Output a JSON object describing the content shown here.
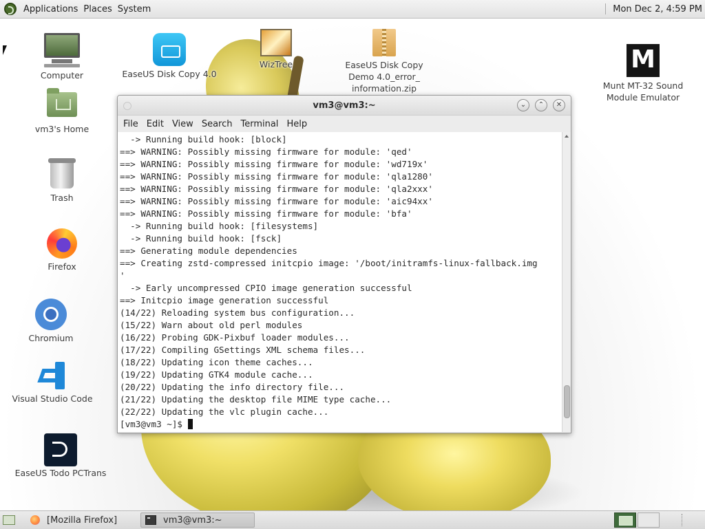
{
  "top_panel": {
    "menus": [
      "Applications",
      "Places",
      "System"
    ],
    "clock": "Mon Dec  2,  4:59 PM",
    "logo_icon": "distro-logo-icon"
  },
  "desktop_icons": [
    {
      "label": "Computer",
      "icon": "computer-icon"
    },
    {
      "label": "vm3's Home",
      "icon": "home-folder-icon"
    },
    {
      "label": "Trash",
      "icon": "trash-icon"
    },
    {
      "label": "Firefox",
      "icon": "firefox-icon"
    },
    {
      "label": "Chromium",
      "icon": "chromium-icon"
    },
    {
      "label": "Visual Studio Code",
      "icon": "vscode-icon"
    },
    {
      "label": "EaseUS Todo PCTrans",
      "icon": "pctrans-icon"
    },
    {
      "label": "EaseUS Disk Copy 4.0",
      "icon": "easeus-disk-copy-icon"
    },
    {
      "label": "WizTree",
      "icon": "wiztree-icon"
    },
    {
      "label": "EaseUS Disk Copy Demo 4.0_error_ information.zip",
      "label_lines": [
        "EaseUS Disk Copy",
        "Demo 4.0_error_",
        "information.zip"
      ],
      "icon": "zip-archive-icon"
    },
    {
      "label": "Munt MT-32 Sound Module Emulator",
      "label_lines": [
        "Munt MT-32 Sound",
        "Module Emulator"
      ],
      "icon": "munt-icon"
    }
  ],
  "terminal": {
    "title": "vm3@vm3:~",
    "menu": [
      "File",
      "Edit",
      "View",
      "Search",
      "Terminal",
      "Help"
    ],
    "lines": [
      "  -> Running build hook: [block]",
      "==> WARNING: Possibly missing firmware for module: 'qed'",
      "==> WARNING: Possibly missing firmware for module: 'wd719x'",
      "==> WARNING: Possibly missing firmware for module: 'qla1280'",
      "==> WARNING: Possibly missing firmware for module: 'qla2xxx'",
      "==> WARNING: Possibly missing firmware for module: 'aic94xx'",
      "==> WARNING: Possibly missing firmware for module: 'bfa'",
      "  -> Running build hook: [filesystems]",
      "  -> Running build hook: [fsck]",
      "==> Generating module dependencies",
      "==> Creating zstd-compressed initcpio image: '/boot/initramfs-linux-fallback.img",
      "'",
      "  -> Early uncompressed CPIO image generation successful",
      "==> Initcpio image generation successful",
      "(14/22) Reloading system bus configuration...",
      "(15/22) Warn about old perl modules",
      "(16/22) Probing GDK-Pixbuf loader modules...",
      "(17/22) Compiling GSettings XML schema files...",
      "(18/22) Updating icon theme caches...",
      "(19/22) Updating GTK4 module cache...",
      "(20/22) Updating the info directory file...",
      "(21/22) Updating the desktop file MIME type cache...",
      "(22/22) Updating the vlc plugin cache..."
    ],
    "prompt": "[vm3@vm3 ~]$ "
  },
  "taskbar": {
    "tasks": [
      {
        "label": "[Mozilla Firefox]",
        "icon": "firefox-icon",
        "active": false
      },
      {
        "label": "vm3@vm3:~",
        "icon": "terminal-icon",
        "active": true
      }
    ]
  }
}
